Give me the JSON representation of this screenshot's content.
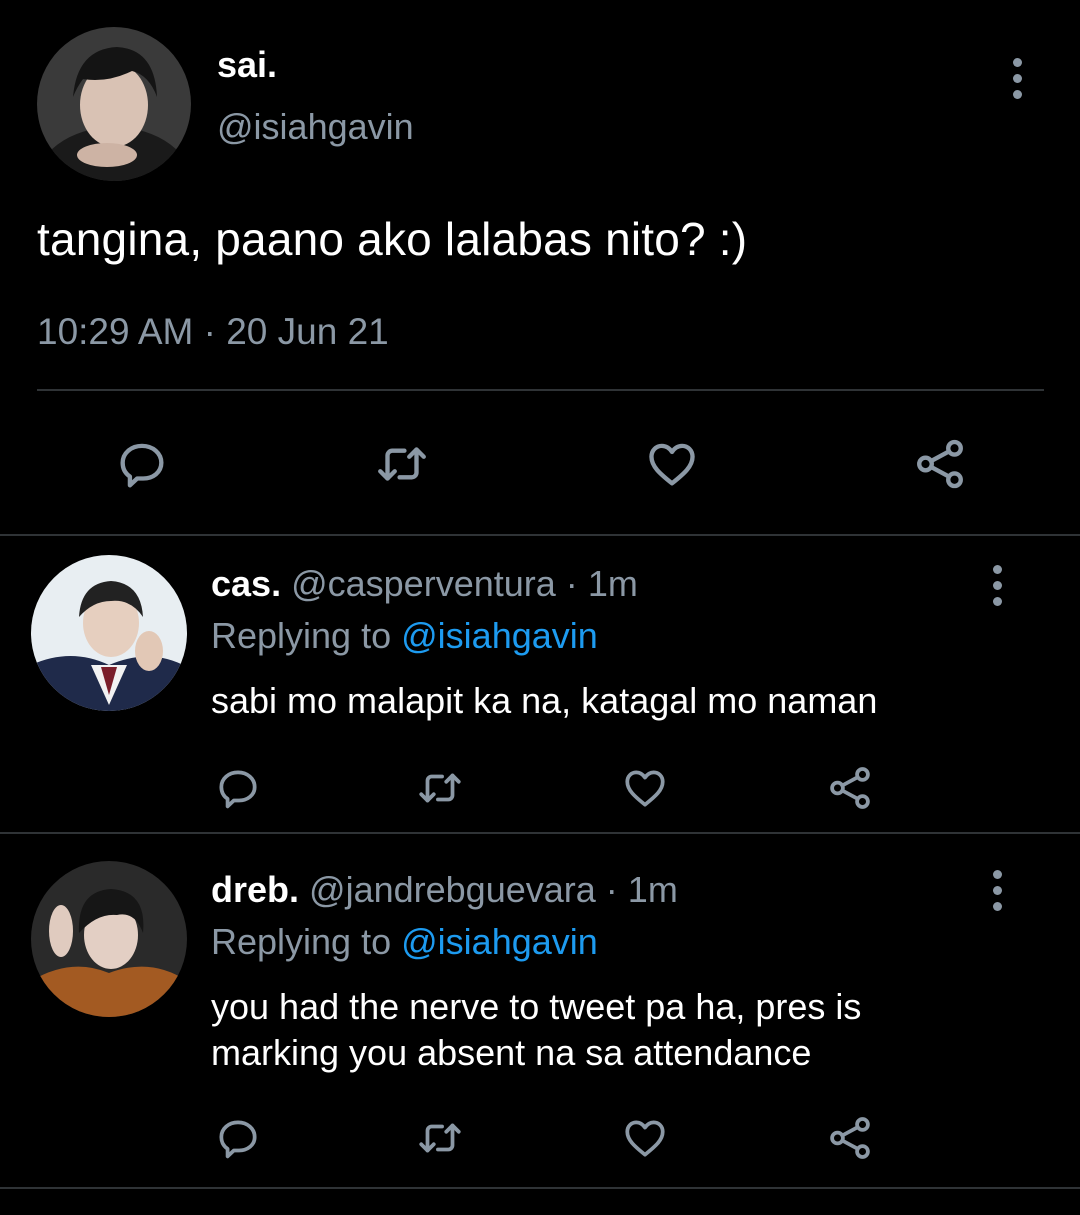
{
  "main_tweet": {
    "name": "sai.",
    "handle": "@isiahgavin",
    "text": "tangina, paano ako lalabas nito? :)",
    "time": "10:29 AM",
    "separator": "·",
    "date": "20 Jun 21",
    "actions": [
      "reply-icon",
      "retweet-icon",
      "like-icon",
      "share-icon"
    ]
  },
  "replies": [
    {
      "name": "cas.",
      "handle": "@casperventura",
      "separator": "·",
      "age": "1m",
      "replying_prefix": "Replying to",
      "replying_to": "@isiahgavin",
      "text_lines": [
        "sabi mo malapit ka na, katagal mo naman"
      ]
    },
    {
      "name": "dreb.",
      "handle": "@jandrebguevara",
      "separator": "·",
      "age": "1m",
      "replying_prefix": "Replying to",
      "replying_to": "@isiahgavin",
      "text_lines": [
        "you had the nerve to tweet pa ha, pres is",
        "marking you absent na sa attendance"
      ]
    }
  ],
  "colors": {
    "background": "#000000",
    "text_primary": "#ffffff",
    "text_secondary": "#8b98a5",
    "link": "#1d9bf0",
    "divider": "#2f3336"
  }
}
